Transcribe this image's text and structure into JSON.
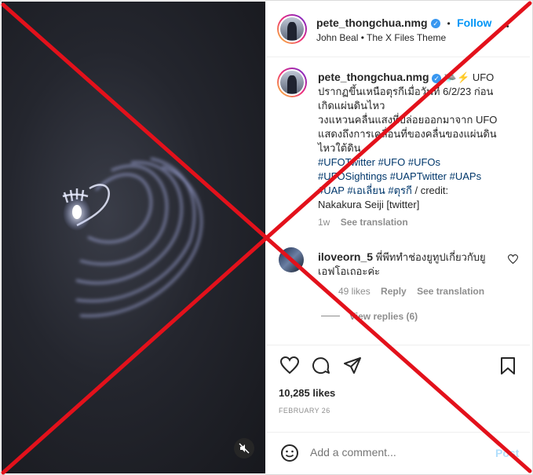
{
  "post": {
    "username": "pete_thongchua.nmg",
    "dot": "•",
    "follow_label": "Follow",
    "audio": "John Beal • The X Files Theme",
    "more_label": "•••",
    "caption_emoji": "🛸⚡",
    "caption_lines": [
      "UFO",
      "ปรากฏขึ้นเหนือตุรกีเมื่อวันที่ 6/2/23 ก่อน",
      "เกิดแผ่นดินไหว",
      "วงแหวนคลื่นแสงที่ปล่อยออกมาจาก UFO",
      "แสดงถึงการเคลื่อนที่ของคลื่นของแผ่นดิน",
      "ไหวใต้ดิน"
    ],
    "hashtags_line1": "#UFOTwitter #UFO #UFOs",
    "hashtags_line2": "#UFOSightings #UAPTwitter #UAPs",
    "hashtags_line3": "#UAP #เอเลี่ยน #ตุรกี",
    "credit_inline": " / credit:",
    "credit_line": "Nakakura Seiji [twitter]",
    "caption_time": "1w",
    "see_translation": "See translation"
  },
  "comment": {
    "username": "iloveorn_5",
    "text_line1": "พี่พีททำช่องยูทูปเกี่ยวกับยู",
    "text_line2": "เอฟโอเถอะค่ะ",
    "likes": "49 likes",
    "reply_label": "Reply",
    "see_translation": "See translation",
    "view_replies": "View replies (6)"
  },
  "engagement": {
    "likes": "10,285 likes",
    "date": "FEBRUARY 26"
  },
  "composer": {
    "placeholder": "Add a comment...",
    "post_label": "Post"
  },
  "colors": {
    "link_blue": "#0095f6",
    "hashtag": "#00376b",
    "overlay_red": "#e3111b"
  }
}
